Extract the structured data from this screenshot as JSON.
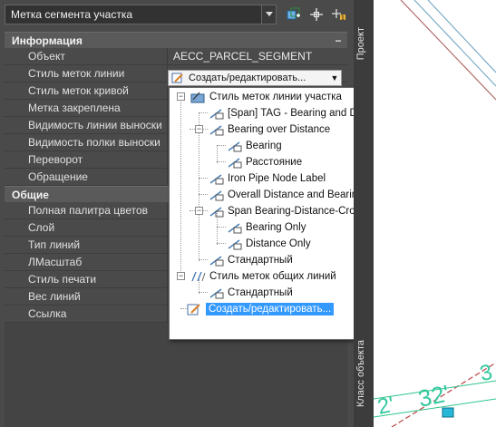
{
  "toolbar": {
    "combo_value": "Метка сегмента участка",
    "icons": [
      "quick-select-icon",
      "pick-object-icon",
      "toggle-pickadd-icon"
    ]
  },
  "panel": {
    "sections": [
      {
        "title": "Информация",
        "rows": [
          {
            "label": "Объект",
            "value": "AECC_PARCEL_SEGMENT"
          },
          {
            "label": "Стиль меток линии",
            "value": ""
          },
          {
            "label": "Стиль меток кривой",
            "value": ""
          },
          {
            "label": "Метка закреплена",
            "value": ""
          },
          {
            "label": "Видимость линии выноски",
            "value": ""
          },
          {
            "label": "Видимость полки выноски",
            "value": ""
          },
          {
            "label": "Переворот",
            "value": ""
          },
          {
            "label": "Обращение",
            "value": ""
          }
        ]
      },
      {
        "title": "Общие",
        "rows": [
          {
            "label": "Полная палитра цветов",
            "value": ""
          },
          {
            "label": "Слой",
            "value": ""
          },
          {
            "label": "Тип линий",
            "value": ""
          },
          {
            "label": "ЛМасштаб",
            "value": ""
          },
          {
            "label": "Стиль печати",
            "value": ""
          },
          {
            "label": "Вес линий",
            "value": ""
          },
          {
            "label": "Ссылка",
            "value": ""
          }
        ]
      }
    ],
    "minimize_glyph": "−",
    "line_style_combo": "Создать/редактировать..."
  },
  "dropdown": {
    "nodes": [
      "Стиль меток линии участка",
      "[Span] TAG - Bearing and Distance with Crows Feet",
      "Bearing over Distance",
      "Bearing",
      "Расстояние",
      "Iron Pipe Node Label",
      "Overall Distance and Bearing",
      "Span Bearing-Distance-Crows Feet",
      "Bearing Only",
      "Distance Only",
      "Стандартный",
      "Стиль меток общих линий",
      "Стандартный",
      "Создать/редактировать..."
    ]
  },
  "sidebar": {
    "tab_project": "Проект",
    "tab_object_class": "Класс объекта"
  },
  "drawing": {
    "labels": [
      "32'",
      "2'",
      "3"
    ]
  }
}
